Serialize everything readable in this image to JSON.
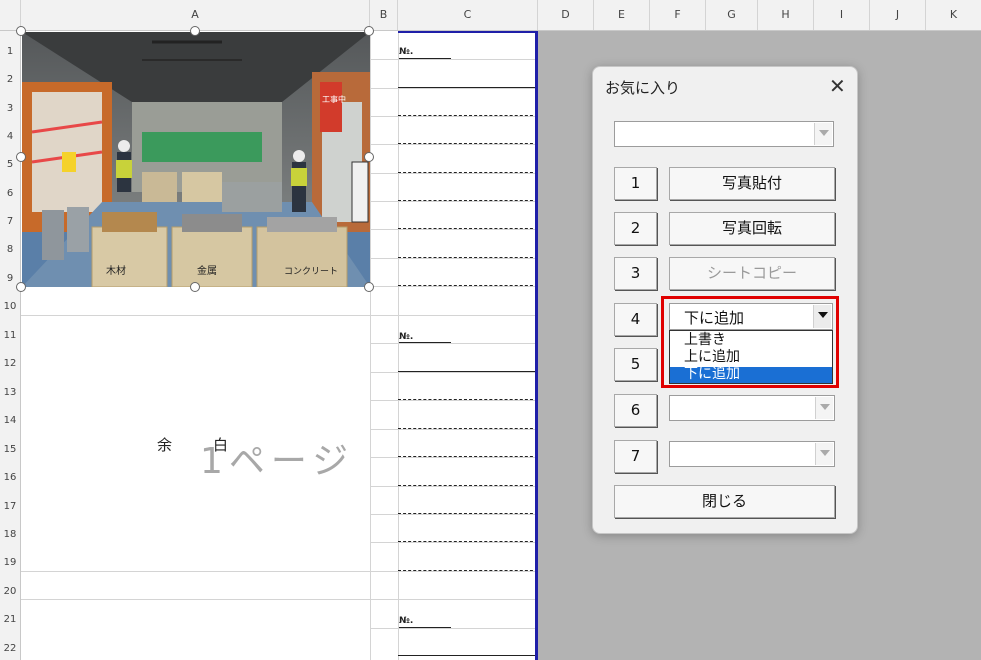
{
  "column_headers": [
    "A",
    "B",
    "C",
    "D",
    "E",
    "F",
    "G",
    "H",
    "I",
    "J",
    "K"
  ],
  "row_headers": [
    "1",
    "2",
    "3",
    "4",
    "5",
    "6",
    "7",
    "8",
    "9",
    "10",
    "11",
    "12",
    "13",
    "14",
    "15",
    "16",
    "17",
    "18",
    "19",
    "20",
    "21",
    "22"
  ],
  "sheet": {
    "no_label": "№.",
    "page_watermark": "1ページ",
    "margin_text_1": "余",
    "margin_text_2": "白",
    "photo_signs": [
      "木材",
      "金属",
      "コンクリート",
      "工事中"
    ]
  },
  "dialog": {
    "title": "お気に入り",
    "close_glyph": "✕",
    "top_combo_value": "",
    "numbers": [
      "1",
      "2",
      "3",
      "4",
      "5",
      "6",
      "7"
    ],
    "buttons": {
      "photo_paste": "写真貼付",
      "photo_rotate": "写真回転",
      "sheet_copy": "シートコピー",
      "close": "閉じる"
    },
    "mode_combo_value": "下に追加",
    "mode_options": [
      "上書き",
      "上に追加",
      "下に追加"
    ],
    "selected_option": "下に追加"
  },
  "colors": {
    "page_border": "#1f1fa8",
    "highlight_box": "#e00000",
    "selection": "#1a6fd4",
    "disabled_text": "#9a9a9a"
  }
}
